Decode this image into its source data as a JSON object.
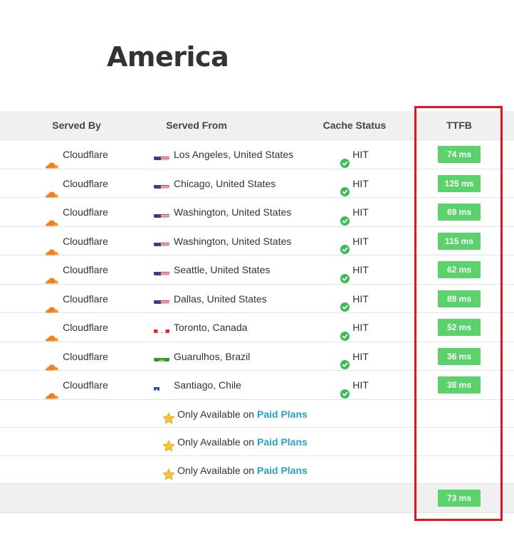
{
  "title": "America",
  "columns": {
    "served_by": "Served By",
    "served_from": "Served From",
    "cache_status": "Cache Status",
    "ttfb": "TTFB"
  },
  "rows": [
    {
      "provider": "Cloudflare",
      "flag": "us",
      "location": "Los Angeles, United States",
      "status": "HIT",
      "ttfb": "74 ms"
    },
    {
      "provider": "Cloudflare",
      "flag": "us",
      "location": "Chicago, United States",
      "status": "HIT",
      "ttfb": "125 ms"
    },
    {
      "provider": "Cloudflare",
      "flag": "us",
      "location": "Washington, United States",
      "status": "HIT",
      "ttfb": "69 ms"
    },
    {
      "provider": "Cloudflare",
      "flag": "us",
      "location": "Washington, United States",
      "status": "HIT",
      "ttfb": "115 ms"
    },
    {
      "provider": "Cloudflare",
      "flag": "us",
      "location": "Seattle, United States",
      "status": "HIT",
      "ttfb": "62 ms"
    },
    {
      "provider": "Cloudflare",
      "flag": "us",
      "location": "Dallas, United States",
      "status": "HIT",
      "ttfb": "89 ms"
    },
    {
      "provider": "Cloudflare",
      "flag": "ca",
      "location": "Toronto, Canada",
      "status": "HIT",
      "ttfb": "52 ms"
    },
    {
      "provider": "Cloudflare",
      "flag": "br",
      "location": "Guarulhos, Brazil",
      "status": "HIT",
      "ttfb": "36 ms"
    },
    {
      "provider": "Cloudflare",
      "flag": "cl",
      "location": "Santiago, Chile",
      "status": "HIT",
      "ttfb": "38 ms"
    }
  ],
  "paid_rows": [
    {
      "prefix": "Only Available on",
      "link": "Paid Plans"
    },
    {
      "prefix": "Only Available on",
      "link": "Paid Plans"
    },
    {
      "prefix": "Only Available on",
      "link": "Paid Plans"
    }
  ],
  "average_ttfb": "73 ms",
  "colors": {
    "badge": "#5bd26c",
    "link": "#2aa1c4",
    "highlight": "#e8111b",
    "check": "#3dbb55",
    "cloudflare": "#f38020"
  },
  "icons": {
    "provider": "cloudflare-cloud-icon",
    "status": "check-circle-icon",
    "paid": "star-icon"
  }
}
